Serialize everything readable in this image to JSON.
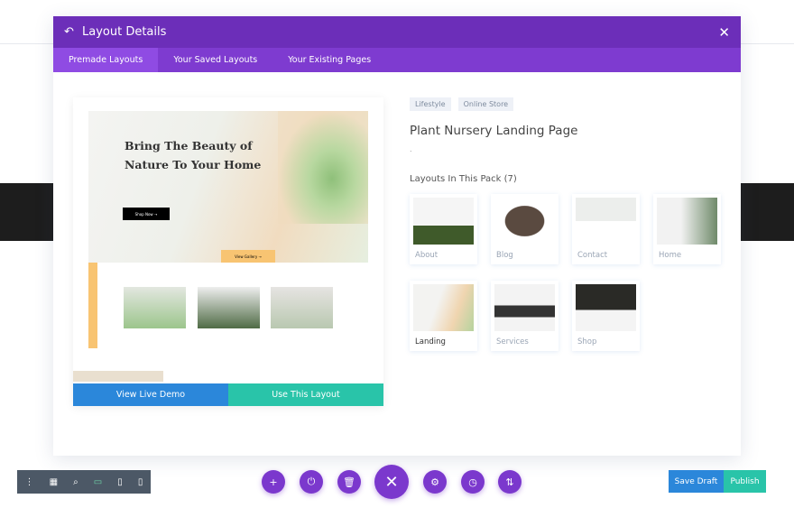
{
  "modal": {
    "title": "Layout Details",
    "back_icon": "undo-arrow-icon",
    "close_icon": "close-icon",
    "tabs": [
      "Premade Layouts",
      "Your Saved Layouts",
      "Your Existing Pages"
    ]
  },
  "preview": {
    "headline": "Bring The Beauty of Nature To Your Home",
    "shop_btn": "Shop Now →",
    "gallery_btn": "View Gallery →",
    "view_demo": "View Live Demo",
    "use_layout": "Use This Layout"
  },
  "details": {
    "tags": [
      "Lifestyle",
      "Online Store"
    ],
    "title": "Plant Nursery Landing Page",
    "description": ".",
    "pack_heading": "Layouts In This Pack (7)",
    "layouts": [
      "About",
      "Blog",
      "Contact",
      "Home",
      "Landing",
      "Services",
      "Shop"
    ],
    "selected": "Landing"
  },
  "toolbar": {
    "save_draft": "Save Draft",
    "publish": "Publish",
    "center_icons": [
      "plus-icon",
      "power-icon",
      "trash-icon",
      "close-icon",
      "gear-icon",
      "history-icon",
      "sort-icon"
    ]
  },
  "colors": {
    "purple": "#6c2eb9",
    "blue": "#2b87da",
    "teal": "#29c4a9"
  }
}
